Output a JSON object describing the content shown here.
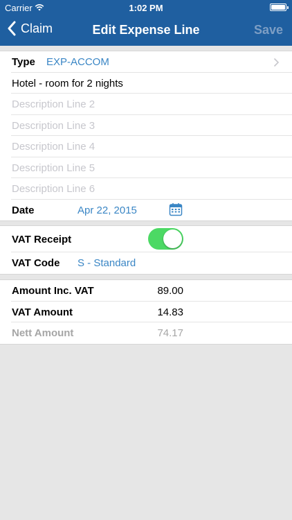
{
  "status_bar": {
    "carrier": "Carrier",
    "time": "1:02 PM"
  },
  "nav": {
    "back_label": "Claim",
    "title": "Edit Expense Line",
    "save_label": "Save"
  },
  "details": {
    "type_label": "Type",
    "type_value": "EXP-ACCOM",
    "description_line_1": "Hotel - room for 2 nights",
    "description_placeholders": [
      "Description Line 2",
      "Description Line 3",
      "Description Line 4",
      "Description Line 5",
      "Description Line 6"
    ],
    "date_label": "Date",
    "date_value": "Apr 22, 2015"
  },
  "vat": {
    "receipt_label": "VAT Receipt",
    "receipt_on": true,
    "code_label": "VAT Code",
    "code_value": "S - Standard"
  },
  "amounts": {
    "inc_vat_label": "Amount Inc. VAT",
    "inc_vat_value": "89.00",
    "vat_amount_label": "VAT Amount",
    "vat_amount_value": "14.83",
    "nett_label": "Nett Amount",
    "nett_value": "74.17"
  },
  "colors": {
    "nav_bar": "#1f5fa0",
    "accent": "#3a86c5",
    "toggle_on": "#4cd964"
  },
  "icons": {
    "back": "chevron-left-icon",
    "disclosure": "chevron-right-icon",
    "date": "calendar-icon"
  }
}
